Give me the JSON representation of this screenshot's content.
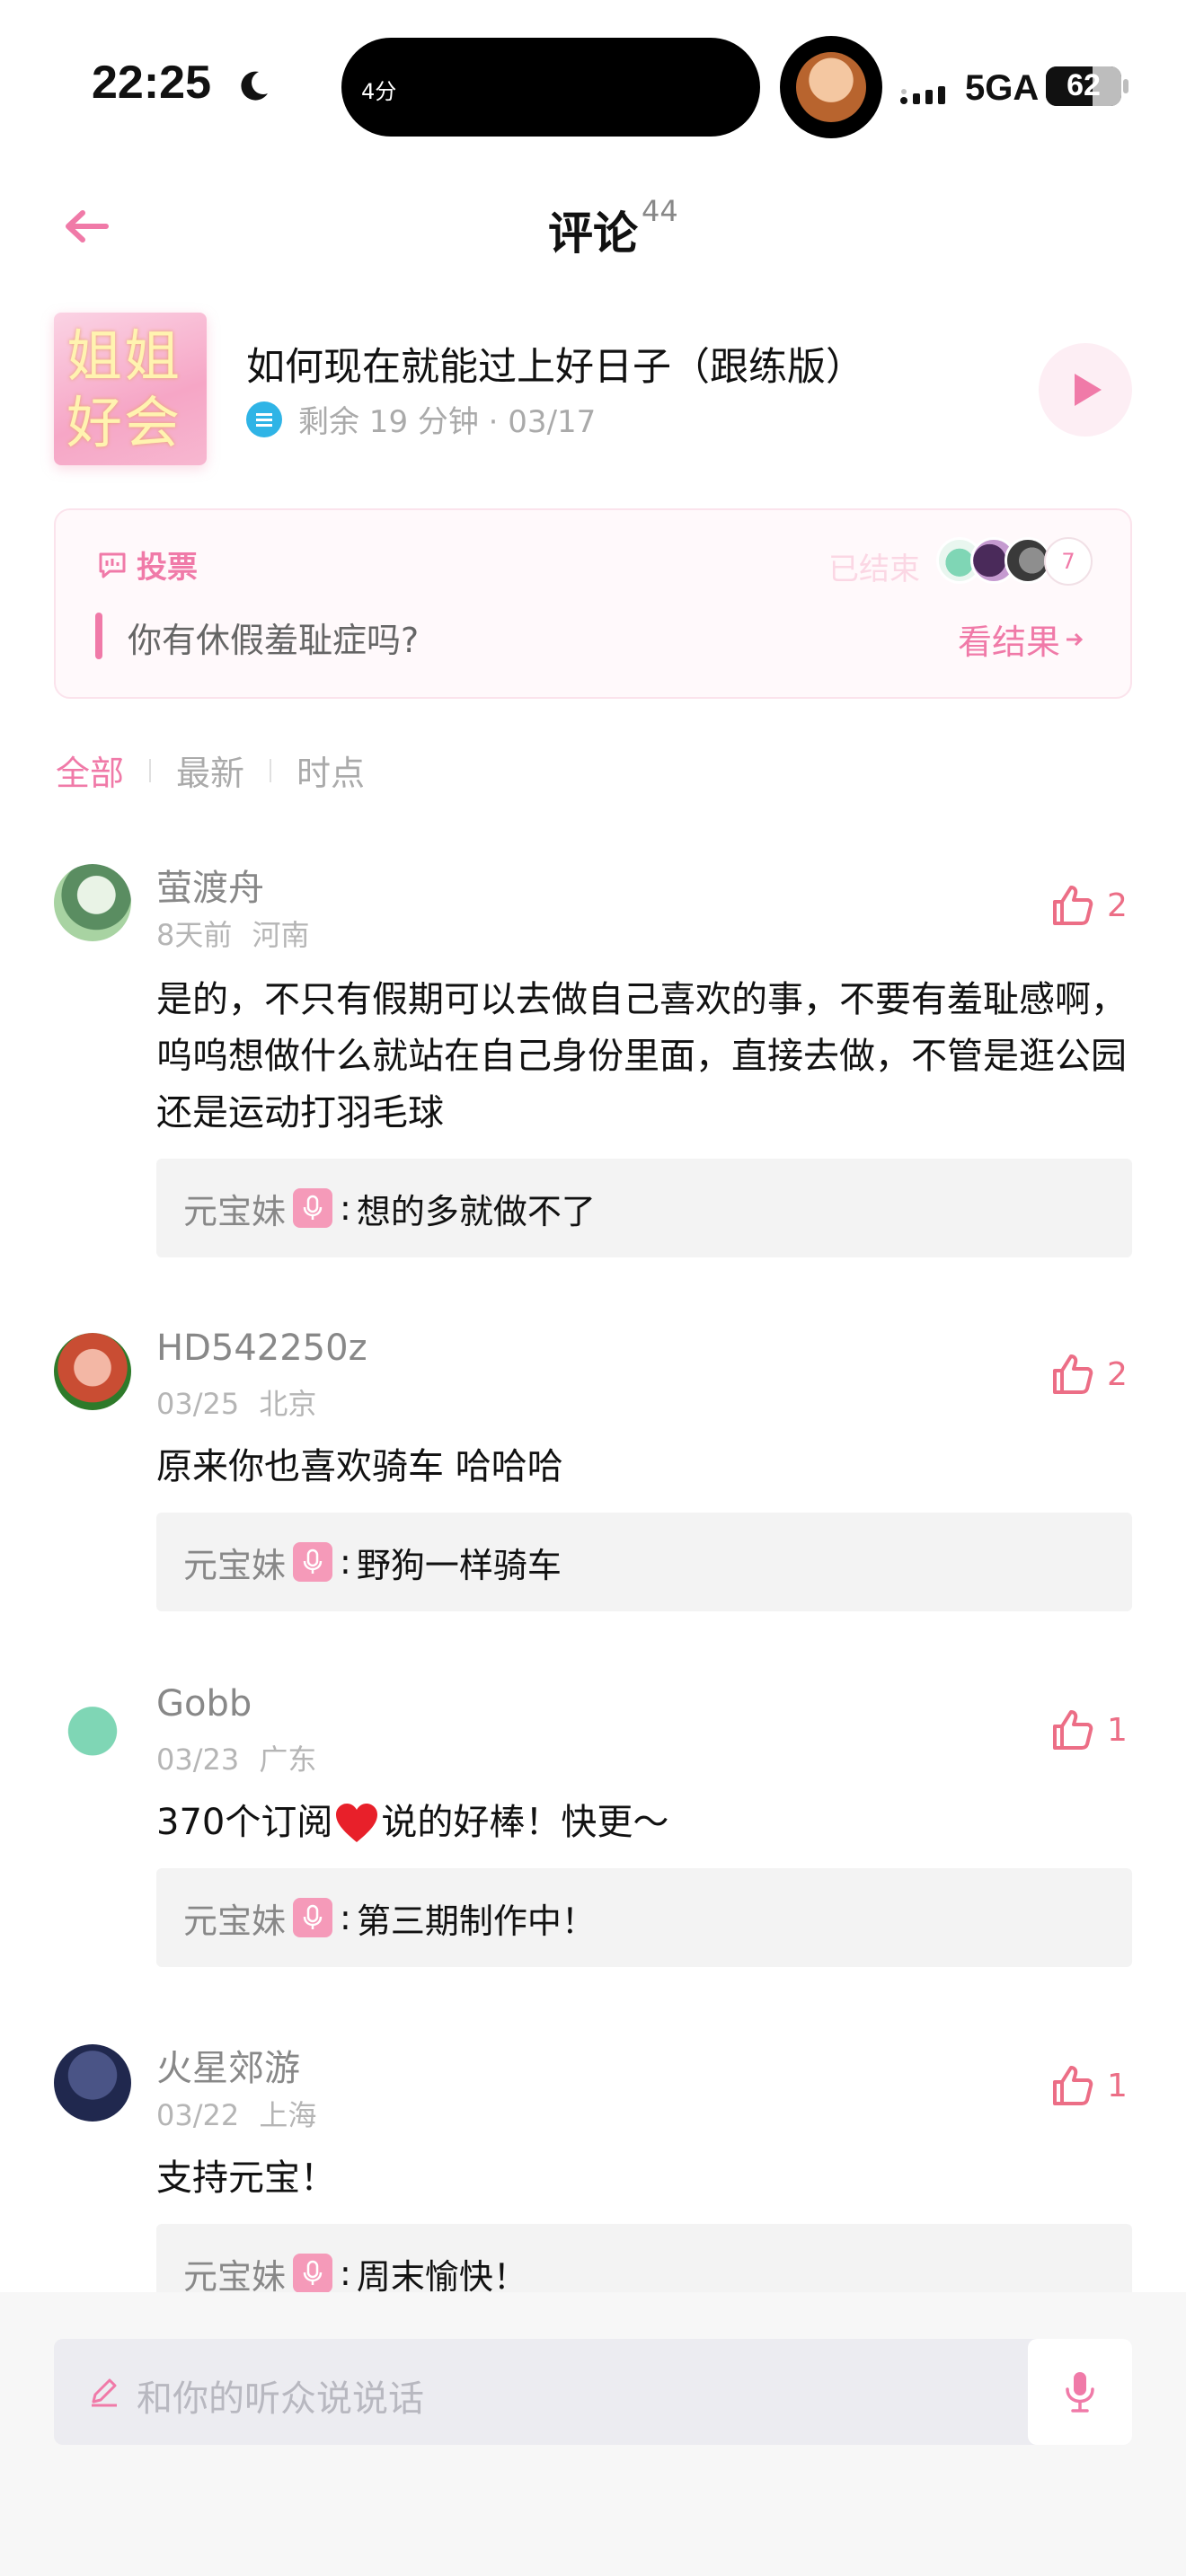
{
  "status_bar": {
    "time": "22:25",
    "island_text": "4分",
    "network": "5GA",
    "battery": "62",
    "battery_level": 0.62
  },
  "header": {
    "title": "评论",
    "count": "44"
  },
  "episode": {
    "cover_text": "姐姐好会",
    "title": "如何现在就能过上好日子（跟练版）",
    "meta": "剩余 19 分钟 · 03/17"
  },
  "vote": {
    "label": "投票",
    "status": "已结束",
    "voter_count": "7",
    "question": "你有休假羞耻症吗?",
    "result_link": "看结果"
  },
  "filters": [
    "全部",
    "最新",
    "时点"
  ],
  "comments": [
    {
      "name": "萤渡舟",
      "meta": "8天前 河南",
      "likes": "2",
      "text": "是的，不只有假期可以去做自己喜欢的事，不要有羞耻感啊，呜呜想做什么就站在自己身份里面，直接去做，不管是逛公园还是运动打羽毛球",
      "reply_name": "元宝妹",
      "reply_text": "想的多就做不了"
    },
    {
      "name": "HD542250z",
      "meta": "03/25 北京",
      "likes": "2",
      "text": "原来你也喜欢骑车 哈哈哈",
      "reply_name": "元宝妹",
      "reply_text": "野狗一样骑车"
    },
    {
      "name": "Gobb",
      "meta": "03/23 广东",
      "likes": "1",
      "text_before": "370个订阅",
      "text_after": "说的好棒！快更～",
      "reply_name": "元宝妹",
      "reply_text": "第三期制作中！"
    },
    {
      "name": "火星郊游",
      "meta": "03/22 上海",
      "likes": "1",
      "text": "支持元宝！",
      "reply_name": "元宝妹",
      "reply_text": "周末愉快！"
    }
  ],
  "reply_sep": ":",
  "input": {
    "placeholder": "和你的听众说说话"
  },
  "colors": {
    "accent": "#f07aa8",
    "like": "#ec6e86",
    "mic_badge": "#f59ab9"
  }
}
